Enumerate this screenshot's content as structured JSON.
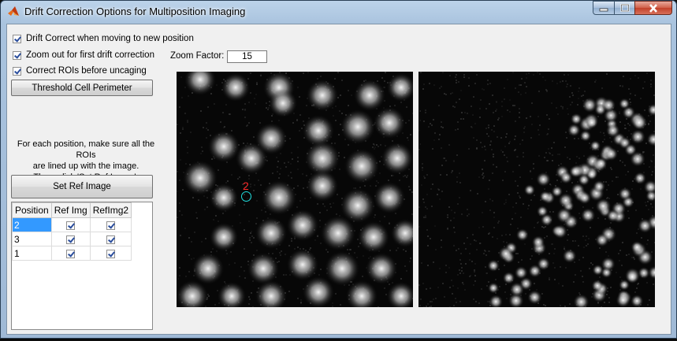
{
  "window": {
    "title": "Drift Correction Options for Multiposition Imaging"
  },
  "icons": {
    "app": "matlab-icon",
    "minimize": "minimize-icon",
    "maximize": "maximize-icon",
    "close": "close-icon"
  },
  "options": {
    "drift_correct_label": "Drift Correct when moving to new position",
    "drift_correct_checked": true,
    "zoom_out_label": "Zoom out for first drift correction",
    "zoom_out_checked": true,
    "correct_rois_label": "Correct ROIs before uncaging",
    "correct_rois_checked": true
  },
  "zoom": {
    "label": "Zoom Factor:",
    "value": "15"
  },
  "buttons": {
    "threshold": "Threshold Cell Perimeter",
    "set_ref": "Set Ref Image"
  },
  "instructions": {
    "line1": "For each position, make sure all the ROIs",
    "line2": "are lined up with the image.",
    "line3": "Then, click 'Set Ref Image'."
  },
  "table": {
    "headers": [
      "Position",
      "Ref Img",
      "RefImg2"
    ],
    "rows": [
      {
        "position": "2",
        "ref_img": true,
        "ref_img2": true,
        "selected": true
      },
      {
        "position": "3",
        "ref_img": true,
        "ref_img2": true,
        "selected": false
      },
      {
        "position": "1",
        "ref_img": true,
        "ref_img2": true,
        "selected": false
      }
    ]
  },
  "roi": {
    "label": "2",
    "color": "#ff2a2a",
    "circle_color": "#20e0e0"
  }
}
